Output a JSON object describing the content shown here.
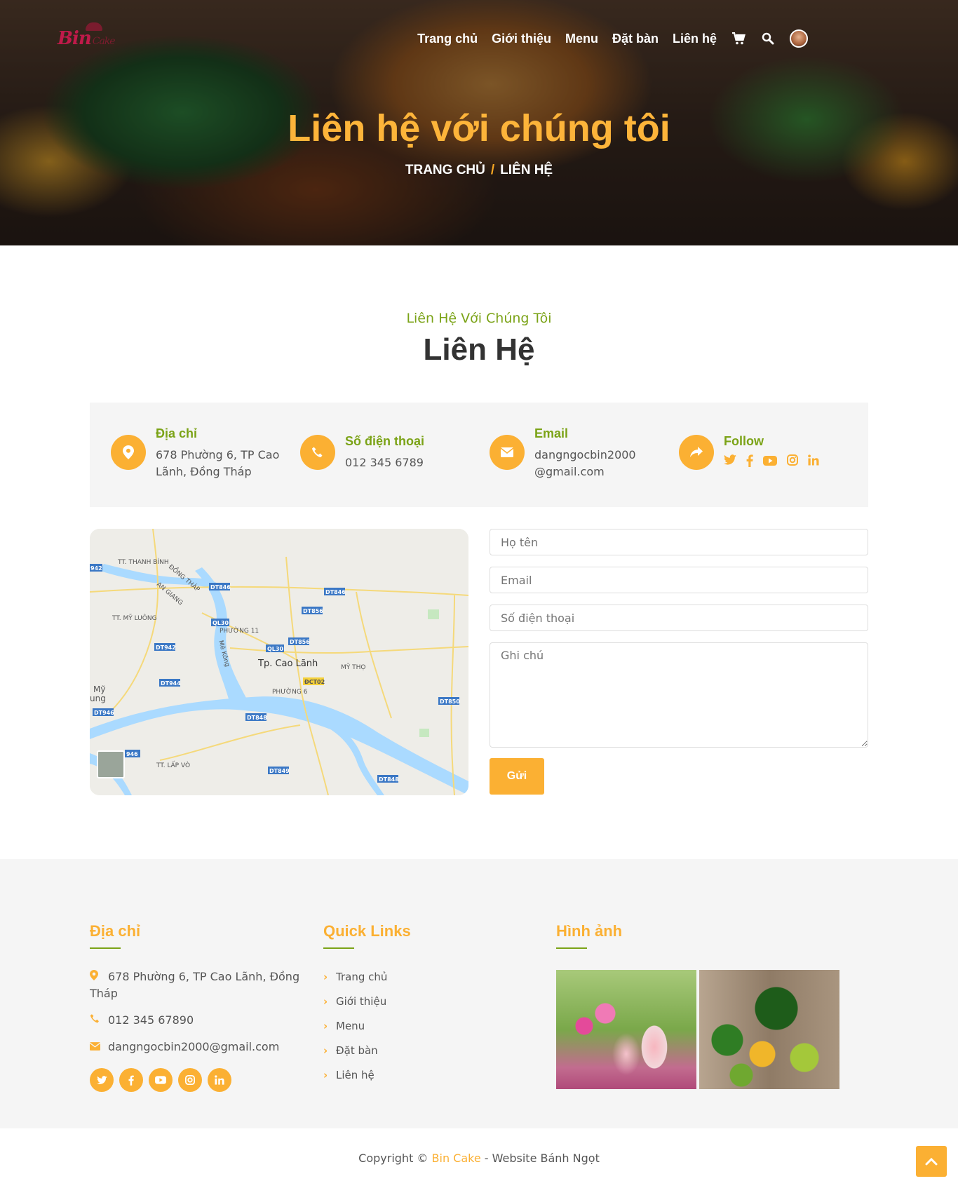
{
  "header": {
    "logo_text": "Bin",
    "logo_suffix": "Cake",
    "nav": [
      "Trang chủ",
      "Giới thiệu",
      "Menu",
      "Đặt bàn",
      "Liên hệ"
    ],
    "icons": [
      "cart-icon",
      "search-icon",
      "avatar"
    ]
  },
  "hero": {
    "title": "Liên hệ với chúng tôi",
    "breadcrumb_home": "TRANG CHỦ",
    "breadcrumb_sep": "/",
    "breadcrumb_current": "LIÊN HỆ"
  },
  "section": {
    "subtitle": "Liên Hệ Với Chúng Tôi",
    "title": "Liên Hệ"
  },
  "info": {
    "address_label": "Địa chỉ",
    "address_line1": "678 Phường 6, TP Cao",
    "address_line2": "Lãnh, Đồng Tháp",
    "phone_label": "Số điện thoại",
    "phone_value": "012 345 6789",
    "email_label": "Email",
    "email_line1": "dangngocbin2000",
    "email_line2": "@gmail.com",
    "follow_label": "Follow"
  },
  "map": {
    "city": "Tp. Cao Lãnh",
    "labels": [
      "TT. THANH BÌNH",
      "ĐỒNG THÁP",
      "AN GIANG",
      "TT. MỸ LUÔNG",
      "PHƯỜNG 11",
      "Mê Kông",
      "MỸ THỌ",
      "PHƯỜNG 6",
      "TT. LẤP VÒ",
      "Mỹ",
      "ung"
    ],
    "roads": [
      "942",
      "DT846",
      "DT846",
      "DT856",
      "QL30",
      "QL30",
      "DT856",
      "DT942",
      "DT944",
      "ĐCT02",
      "DT850",
      "DT946",
      "DT848",
      "946",
      "DT849",
      "DT848"
    ]
  },
  "form": {
    "name_placeholder": "Họ tên",
    "email_placeholder": "Email",
    "phone_placeholder": "Số điện thoại",
    "note_placeholder": "Ghi chú",
    "submit_label": "Gửi"
  },
  "footer": {
    "address_heading": "Địa chỉ",
    "address_line1": "678 Phường 6, TP Cao Lãnh, Đồng",
    "address_line2": "Tháp",
    "phone": "012 345 67890",
    "email": "dangngocbin2000@gmail.com",
    "links_heading": "Quick Links",
    "links": [
      "Trang chủ",
      "Giới thiệu",
      "Menu",
      "Đặt bàn",
      "Liên hệ"
    ],
    "gallery_heading": "Hình ảnh"
  },
  "copyright": {
    "prefix": "Copyright ©",
    "brand": "Bin Cake",
    "suffix": "- Website Bánh Ngọt"
  },
  "colors": {
    "accent": "#fbb033",
    "green": "#7ba317",
    "hero_title": "#fdb43a"
  }
}
